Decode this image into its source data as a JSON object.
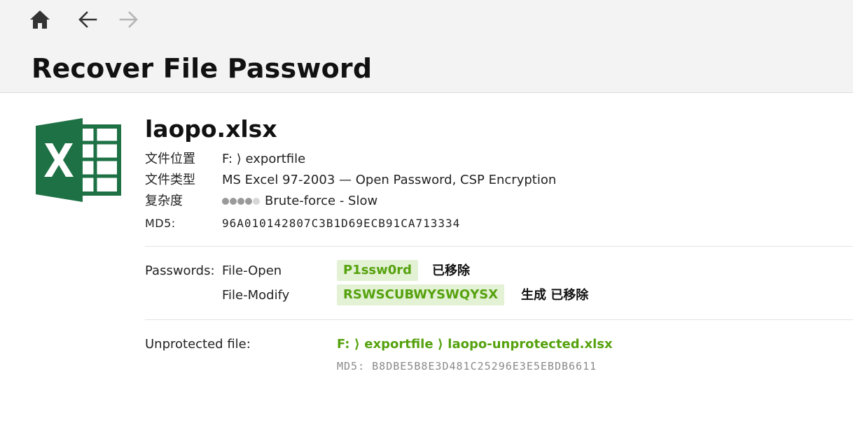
{
  "header": {
    "title": "Recover File Password",
    "nav": {
      "home_icon": "home-icon",
      "back_icon": "arrow-left-icon",
      "forward_icon": "arrow-right-icon"
    }
  },
  "file": {
    "icon": "excel-file-icon",
    "name": "laopo.xlsx",
    "location_label": "文件位置",
    "location_value": "F: ⟩ exportfile",
    "type_label": "文件类型",
    "type_value": "MS Excel 97-2003 — Open Password, CSP Encryption",
    "complexity_label": "复杂度",
    "complexity_level": 4,
    "complexity_max": 5,
    "complexity_value": "Brute-force - Slow",
    "md5_label": "MD5:",
    "md5_value": "96A010142807C3B1D69ECB91CA713334"
  },
  "passwords": {
    "label": "Passwords:",
    "items": [
      {
        "type": "File-Open",
        "value": "P1ssw0rd",
        "note": "已移除"
      },
      {
        "type": "File-Modify",
        "value": "RSWSCUBWYSWQYSX",
        "note": "生成 已移除"
      }
    ]
  },
  "unprotected": {
    "label": "Unprotected file:",
    "path": "F: ⟩ exportfile ⟩ laopo-unprotected.xlsx",
    "md5": "MD5: B8DBE5B8E3D481C25296E3E5EBDB6611"
  },
  "colors": {
    "accent_green": "#55a20e",
    "highlight_bg": "#e3f1d4",
    "excel_green": "#1e7145"
  }
}
